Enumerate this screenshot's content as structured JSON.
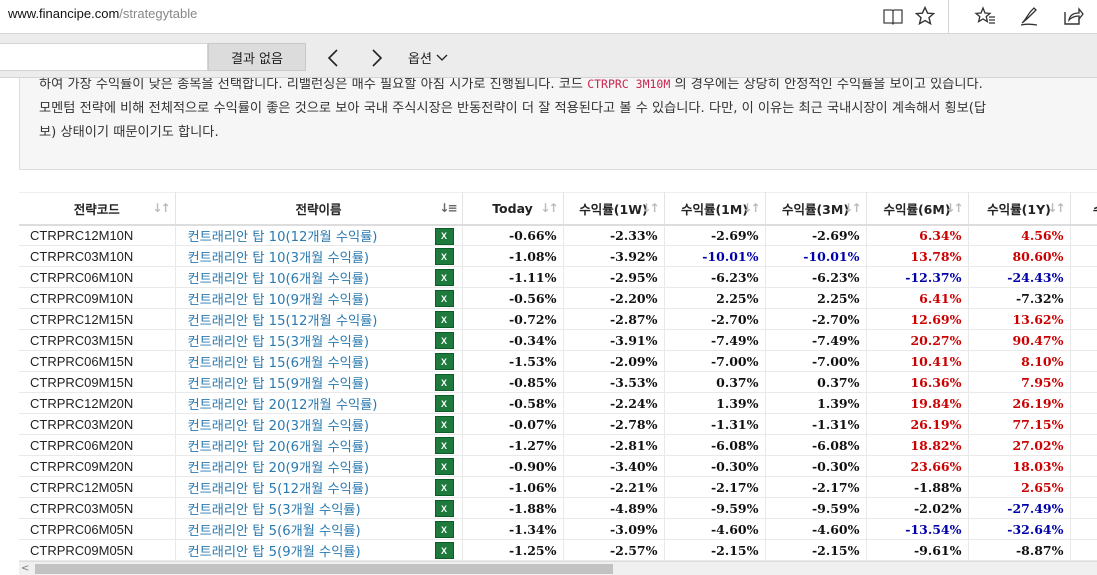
{
  "browser": {
    "url_host": "www.financipe.com",
    "url_path": "/strategytable",
    "icons": [
      "reading-view-icon",
      "favorite-star-icon",
      "favorites-list-icon",
      "pen-icon",
      "share-icon"
    ]
  },
  "find_bar": {
    "input_value": "",
    "result": "결과 없음",
    "options": "옵션"
  },
  "description": {
    "line1_a": "하여 가장 수익률이 낮은 종목을 선택합니다. 리밸런싱은 매수 필요할 아침 시가로 진행됩니다. 코드 ",
    "line1_code": "CTRPRC 3M10M",
    "line1_b": " 의 경우에는 상당히 안정적인 수익률을 보이고 있습니다.",
    "line2": "모멘텀 전략에 비해 전체적으로 수익률이 좋은 것으로 보아 국내 주식시장은 반동전략이 더 잘 적용된다고 볼 수 있습니다. 다만, 이 이유는 최근 국내시장이 계속해서 횡보(답",
    "line3": "보) 상태이기 때문이기도 합니다."
  },
  "table": {
    "headers": {
      "code": "전략코드",
      "name": "전략이름",
      "today": "Today",
      "w1": "수익률(1W)",
      "m1": "수익률(1M)",
      "m3": "수익률(3M)",
      "m6": "수익률(6M)",
      "y1": "수익률(1Y)",
      "extra": "수익"
    },
    "excel_label": "X",
    "rows": [
      {
        "code": "CTRPRC12M10N",
        "name": "컨트래리안 탑 10(12개월 수익률)",
        "today": "-0.66%",
        "w1": "-2.33%",
        "m1": "-2.69%",
        "m3": "-2.69%",
        "m6": "6.34%",
        "y1": "4.56%"
      },
      {
        "code": "CTRPRC03M10N",
        "name": "컨트래리안 탑 10(3개월 수익률)",
        "today": "-1.08%",
        "w1": "-3.92%",
        "m1": "-10.01%",
        "m3": "-10.01%",
        "m6": "13.78%",
        "y1": "80.60%"
      },
      {
        "code": "CTRPRC06M10N",
        "name": "컨트래리안 탑 10(6개월 수익률)",
        "today": "-1.11%",
        "w1": "-2.95%",
        "m1": "-6.23%",
        "m3": "-6.23%",
        "m6": "-12.37%",
        "y1": "-24.43%"
      },
      {
        "code": "CTRPRC09M10N",
        "name": "컨트래리안 탑 10(9개월 수익률)",
        "today": "-0.56%",
        "w1": "-2.20%",
        "m1": "2.25%",
        "m3": "2.25%",
        "m6": "6.41%",
        "y1": "-7.32%"
      },
      {
        "code": "CTRPRC12M15N",
        "name": "컨트래리안 탑 15(12개월 수익률)",
        "today": "-0.72%",
        "w1": "-2.87%",
        "m1": "-2.70%",
        "m3": "-2.70%",
        "m6": "12.69%",
        "y1": "13.62%"
      },
      {
        "code": "CTRPRC03M15N",
        "name": "컨트래리안 탑 15(3개월 수익률)",
        "today": "-0.34%",
        "w1": "-3.91%",
        "m1": "-7.49%",
        "m3": "-7.49%",
        "m6": "20.27%",
        "y1": "90.47%"
      },
      {
        "code": "CTRPRC06M15N",
        "name": "컨트래리안 탑 15(6개월 수익률)",
        "today": "-1.53%",
        "w1": "-2.09%",
        "m1": "-7.00%",
        "m3": "-7.00%",
        "m6": "10.41%",
        "y1": "8.10%"
      },
      {
        "code": "CTRPRC09M15N",
        "name": "컨트래리안 탑 15(9개월 수익률)",
        "today": "-0.85%",
        "w1": "-3.53%",
        "m1": "0.37%",
        "m3": "0.37%",
        "m6": "16.36%",
        "y1": "7.95%"
      },
      {
        "code": "CTRPRC12M20N",
        "name": "컨트래리안 탑 20(12개월 수익률)",
        "today": "-0.58%",
        "w1": "-2.24%",
        "m1": "1.39%",
        "m3": "1.39%",
        "m6": "19.84%",
        "y1": "26.19%"
      },
      {
        "code": "CTRPRC03M20N",
        "name": "컨트래리안 탑 20(3개월 수익률)",
        "today": "-0.07%",
        "w1": "-2.78%",
        "m1": "-1.31%",
        "m3": "-1.31%",
        "m6": "26.19%",
        "y1": "77.15%"
      },
      {
        "code": "CTRPRC06M20N",
        "name": "컨트래리안 탑 20(6개월 수익률)",
        "today": "-1.27%",
        "w1": "-2.81%",
        "m1": "-6.08%",
        "m3": "-6.08%",
        "m6": "18.82%",
        "y1": "27.02%"
      },
      {
        "code": "CTRPRC09M20N",
        "name": "컨트래리안 탑 20(9개월 수익률)",
        "today": "-0.90%",
        "w1": "-3.40%",
        "m1": "-0.30%",
        "m3": "-0.30%",
        "m6": "23.66%",
        "y1": "18.03%"
      },
      {
        "code": "CTRPRC12M05N",
        "name": "컨트래리안 탑 5(12개월 수익률)",
        "today": "-1.06%",
        "w1": "-2.21%",
        "m1": "-2.17%",
        "m3": "-2.17%",
        "m6": "-1.88%",
        "y1": "2.65%"
      },
      {
        "code": "CTRPRC03M05N",
        "name": "컨트래리안 탑 5(3개월 수익률)",
        "today": "-1.88%",
        "w1": "-4.89%",
        "m1": "-9.59%",
        "m3": "-9.59%",
        "m6": "-2.02%",
        "y1": "-27.49%"
      },
      {
        "code": "CTRPRC06M05N",
        "name": "컨트래리안 탑 5(6개월 수익률)",
        "today": "-1.34%",
        "w1": "-3.09%",
        "m1": "-4.60%",
        "m3": "-4.60%",
        "m6": "-13.54%",
        "y1": "-32.64%"
      },
      {
        "code": "CTRPRC09M05N",
        "name": "컨트래리안 탑 5(9개월 수익률)",
        "today": "-1.25%",
        "w1": "-2.57%",
        "m1": "-2.15%",
        "m3": "-2.15%",
        "m6": "-9.61%",
        "y1": "-8.87%"
      }
    ]
  },
  "colors": {
    "positive_strong": "#cc0000",
    "negative_strong": "#0000aa",
    "link": "#2a7ab0",
    "excel_green": "#1d7a3c"
  }
}
